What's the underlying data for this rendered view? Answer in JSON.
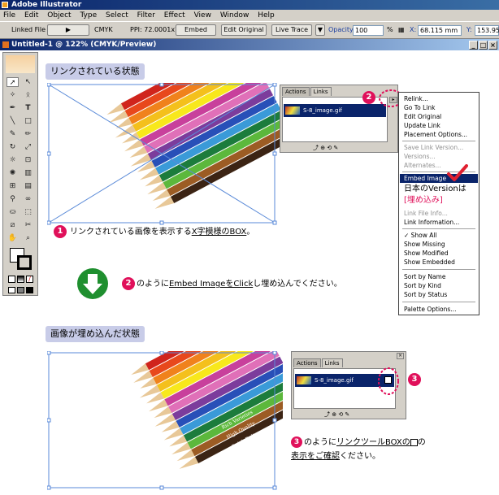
{
  "app": {
    "title": "Adobe Illustrator"
  },
  "menu": [
    "File",
    "Edit",
    "Object",
    "Type",
    "Select",
    "Filter",
    "Effect",
    "View",
    "Window",
    "Help"
  ],
  "control": {
    "linked_file": "Linked File",
    "color_mode": "CMYK",
    "ppi": "PPI: 72.0001x72",
    "embed": "Embed",
    "edit_original": "Edit Original",
    "live_trace": "Live Trace",
    "opacity_label": "Opacity:",
    "opacity_value": "100",
    "percent": "%",
    "x_label": "X:",
    "x_value": "68.115 mm",
    "y_label": "Y:",
    "y_value": "153.95"
  },
  "document": {
    "title": "Untitled-1 @ 122% (CMYK/Preview)"
  },
  "sections": {
    "linked_state": "リンクされている状態",
    "embedded_state": "画像が埋め込んだ状態"
  },
  "panel_top": {
    "tabs": [
      "Actions",
      "Links"
    ],
    "file": "S-8_image.gif"
  },
  "panel_bottom": {
    "tabs": [
      "Actions",
      "Links"
    ],
    "file": "S-8_image.gif"
  },
  "context_menu": {
    "items": [
      "Relink...",
      "Go To Link",
      "Edit Original",
      "Update Link",
      "Placement Options..."
    ],
    "disabled_items": [
      "Save Link Version...",
      "Versions...",
      "Alternates..."
    ],
    "selected": "Embed Image",
    "note_line1": "日本のVersionは",
    "note_line2": "[埋め込み]",
    "hidden_items": [
      "Link File Info...",
      "Link Information..."
    ],
    "show_items": [
      "Show All",
      "Show Missing",
      "Show Modified",
      "Show Embedded"
    ],
    "sort_items": [
      "Sort by Name",
      "Sort by Kind",
      "Sort by Status"
    ],
    "palette": "Palette Options..."
  },
  "notes": {
    "n1": "1",
    "n1_pre": "リンクされている画像を表示する",
    "n1_u": "X字模様のBOX",
    "n1_post": "。",
    "n2": "2",
    "n2_pre": "のように",
    "n2_u": "Embed ImageをClick",
    "n2_post": "し埋め込んでください。",
    "n3": "3",
    "n3_pre": "のように",
    "n3_u": "リンクツールBOXの",
    "n3_post": "の",
    "n3_line2_u": "表示をご確認",
    "n3_line2_post": "ください。"
  },
  "image_captions": [
    "Rich Varieties",
    "High Quality",
    "Quick Delivery"
  ],
  "colors": {
    "accent": "#e0105a",
    "arrow": "#1f8f2f",
    "heading_bg": "#c8cce8",
    "selection": "#0a246a"
  }
}
